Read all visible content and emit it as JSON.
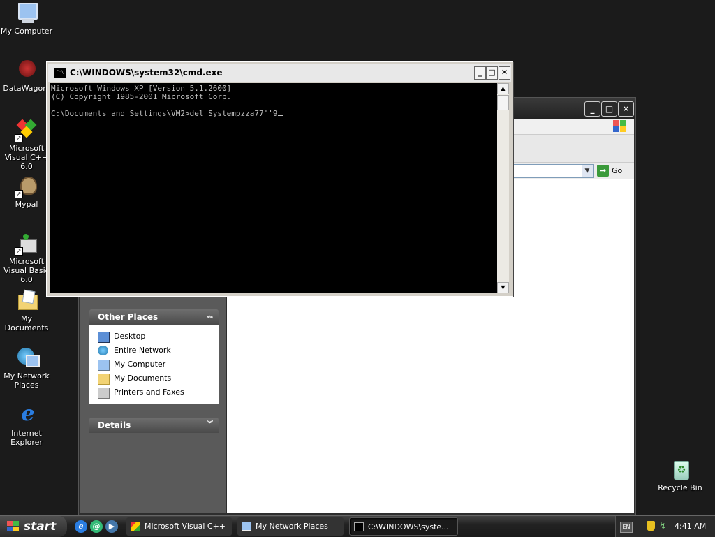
{
  "desktop": {
    "icons": [
      {
        "label": "My Computer"
      },
      {
        "label": "DataWagon."
      },
      {
        "label": "Microsoft Visual C++ 6.0"
      },
      {
        "label": "Mypal"
      },
      {
        "label": "Microsoft Visual Basic 6.0"
      },
      {
        "label": "My Documents"
      },
      {
        "label": "My Network Places"
      },
      {
        "label": "Internet Explorer"
      },
      {
        "label": "Recycle Bin"
      }
    ]
  },
  "explorer": {
    "go_label": "Go",
    "other_places": {
      "title": "Other Places",
      "items": [
        "Desktop",
        "Entire Network",
        "My Computer",
        "My Documents",
        "Printers and Faxes"
      ]
    },
    "details": {
      "title": "Details"
    }
  },
  "cmd": {
    "title": "C:\\WINDOWS\\system32\\cmd.exe",
    "lines": [
      "Microsoft Windows XP [Version 5.1.2600]",
      "(C) Copyright 1985-2001 Microsoft Corp.",
      "",
      "C:\\Documents and Settings\\VM2>del Systempzza77''9"
    ]
  },
  "taskbar": {
    "start_label": "start",
    "tasks": [
      {
        "label": "Microsoft Visual C++",
        "active": false
      },
      {
        "label": "My Network Places",
        "active": false
      },
      {
        "label": "C:\\WINDOWS\\syste...",
        "active": true
      }
    ],
    "tray": {
      "language": "EN",
      "clock": "4:41 AM"
    }
  },
  "icons": {
    "cmd": "command-prompt-icon",
    "ie": "internet-explorer-icon",
    "recycle": "recycle-bin-icon"
  },
  "colors": {
    "desktop_bg": "#1b1b1b",
    "console_bg": "#000000",
    "console_text": "#c0c0c0",
    "go_green": "#3a9a3a"
  }
}
